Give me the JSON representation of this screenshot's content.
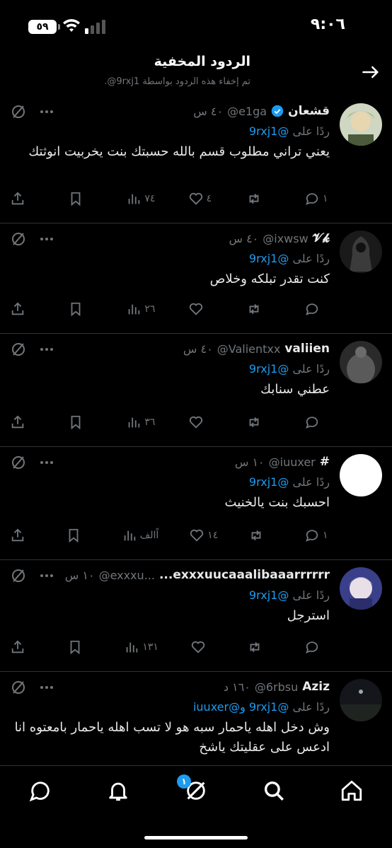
{
  "status": {
    "time": "٩:٠٦",
    "battery": "٥٩"
  },
  "header": {
    "title": "الردود المخفية",
    "subtitle": "تم إخفاء هذه الردود بواسطة 9rxj1@."
  },
  "tweets": [
    {
      "name": "قشعان",
      "handle": "@e1ga",
      "time": "٤٠ س",
      "verified": true,
      "reply_label": "ردًا على",
      "reply_to": "@9rxj1",
      "text": "يعني تراني مطلوب قسم بالله حسبتك بنت يخربيت انوثتك",
      "replies": "١",
      "likes": "٤",
      "views": "٧٤"
    },
    {
      "name": "𝓥𝓴",
      "handle": "@ixwsw",
      "time": "٤٠ س",
      "verified": false,
      "reply_label": "ردًا على",
      "reply_to": "@9rxj1",
      "text": "كنت تقدر تبلكه وخلاص",
      "replies": "",
      "likes": "",
      "views": "٢٦"
    },
    {
      "name": "valiien",
      "handle": "@Valientxx",
      "time": "٤٠ س",
      "verified": false,
      "reply_label": "ردًا على",
      "reply_to": "@9rxj1",
      "text": "عطني سنابك",
      "replies": "",
      "likes": "",
      "views": "٣٦"
    },
    {
      "name": "#",
      "handle": "@iuuxer",
      "time": "١٠ س",
      "verified": false,
      "reply_label": "ردًا على",
      "reply_to": "@9rxj1",
      "text": "احسبك بنت يالخنيث",
      "replies": "١",
      "likes": "١٤",
      "views": "اًالف"
    },
    {
      "name": "exxxuucaaalibaaarrrrrr...",
      "handle": "@exxxu...",
      "time": "١٠ س",
      "verified": false,
      "reply_label": "ردًا على",
      "reply_to": "@9rxj1",
      "text": "استرجل",
      "replies": "",
      "likes": "",
      "views": "١٣١"
    },
    {
      "name": "Aziz",
      "handle": "@6rbsu",
      "time": "١٦٠ د",
      "verified": false,
      "reply_label": "ردًا على",
      "reply_to": "@9rxj1",
      "reply_extra_sep": "و",
      "reply_extra": "@iuuxer",
      "text": "وش دخل اهله ياحمار سبه هو لا تسب اهله ياحمار بامعتوه انا ادعس على عقليتك ياشخ",
      "replies": "",
      "likes": "",
      "views": ""
    }
  ],
  "nav": {
    "badge": "١"
  },
  "icons": [
    "back-arrow-icon",
    "verified-icon",
    "hide-icon",
    "more-icon",
    "reply-icon",
    "retweet-icon",
    "like-icon",
    "views-icon",
    "bookmark-icon",
    "share-icon",
    "home-icon",
    "search-icon",
    "grok-icon",
    "bell-icon",
    "chat-icon"
  ],
  "colors": {
    "accent": "#1d9bf0",
    "muted": "#71767b",
    "background": "#000000",
    "divider": "#2f3336"
  }
}
